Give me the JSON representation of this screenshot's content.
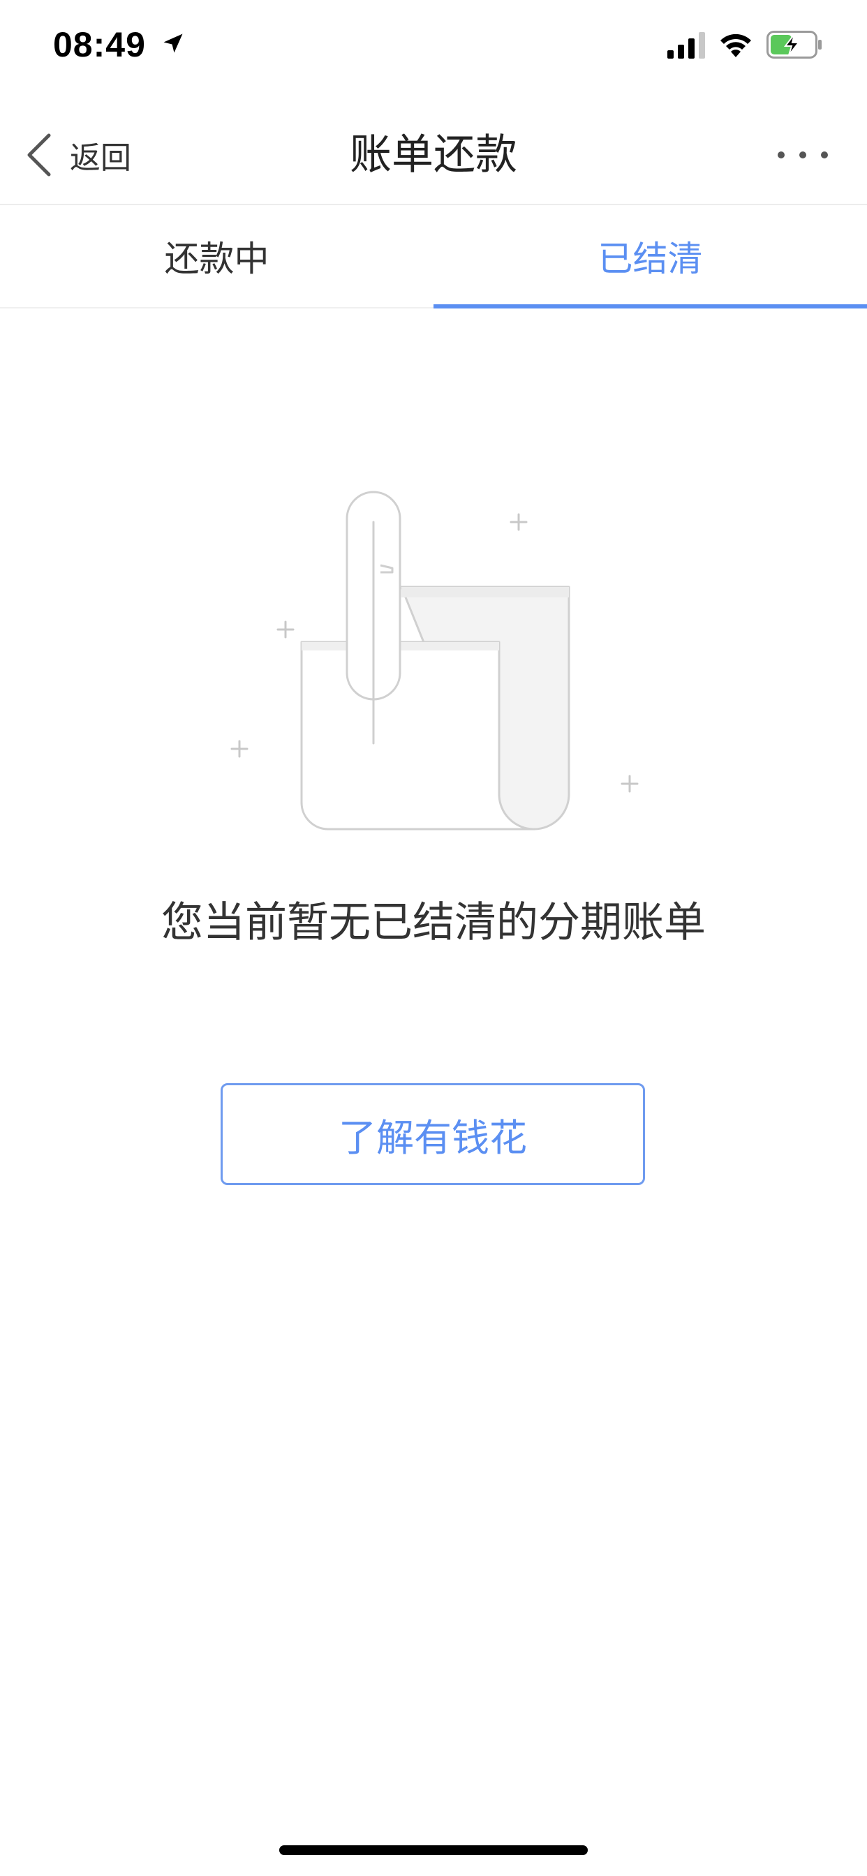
{
  "status_bar": {
    "time": "08:49",
    "location_icon": "location-arrow-icon",
    "signal_icon": "cellular-signal-icon",
    "wifi_icon": "wifi-icon",
    "battery_icon": "battery-charging-icon",
    "battery_color": "#5ac85a"
  },
  "nav": {
    "back_label": "返回",
    "title": "账单还款",
    "back_icon": "chevron-left-icon",
    "more_icon": "more-dots-icon"
  },
  "tabs": [
    {
      "label": "还款中",
      "active": false
    },
    {
      "label": "已结清",
      "active": true
    }
  ],
  "empty_state": {
    "illustration_icon": "empty-scroll-pen-icon",
    "message": "您当前暂无已结清的分期账单",
    "button_label": "了解有钱花"
  },
  "colors": {
    "accent": "#5b8ff2",
    "text_primary": "#222222",
    "divider": "#ececec"
  }
}
